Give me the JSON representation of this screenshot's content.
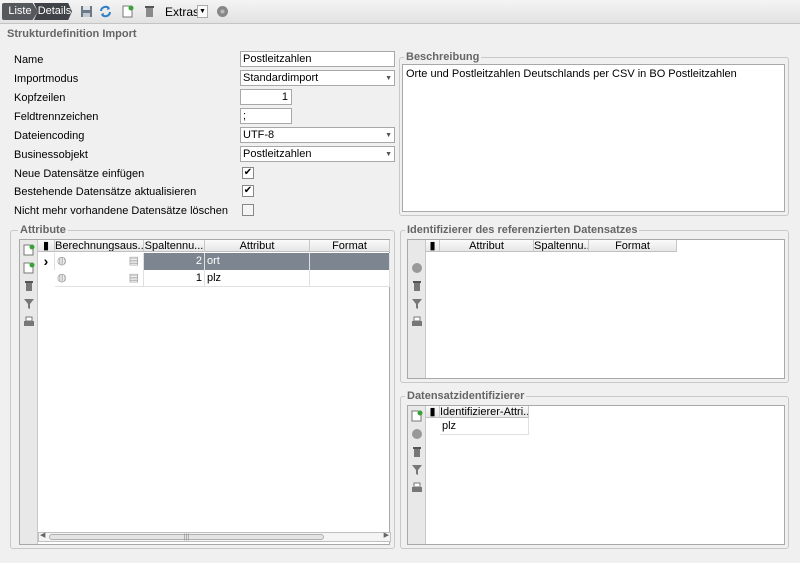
{
  "toolbar": {
    "breadcrumb": [
      "Liste",
      "Details"
    ],
    "extras_label": "Extras"
  },
  "form": {
    "section_title": "Strukturdefinition Import",
    "name_label": "Name",
    "name_value": "Postleitzahlen",
    "importmodus_label": "Importmodus",
    "importmodus_value": "Standardimport",
    "kopfzeilen_label": "Kopfzeilen",
    "kopfzeilen_value": "1",
    "feldtrenn_label": "Feldtrennzeichen",
    "feldtrenn_value": ";",
    "encoding_label": "Dateiencoding",
    "encoding_value": "UTF-8",
    "bo_label": "Businessobjekt",
    "bo_value": "Postleitzahlen",
    "neue_label": "Neue Datensätze einfügen",
    "neue_checked": true,
    "bestehende_label": "Bestehende Datensätze aktualisieren",
    "bestehende_checked": true,
    "nicht_mehr_label": "Nicht mehr vorhandene Datensätze löschen",
    "nicht_mehr_checked": false
  },
  "beschreibung": {
    "title": "Beschreibung",
    "text": "Orte und Postleitzahlen Deutschlands per CSV in BO Postleitzahlen"
  },
  "attribute": {
    "title": "Attribute",
    "columns": [
      "Berechnungsaus...",
      "Spaltennu...",
      "Attribut",
      "Format"
    ],
    "rows": [
      {
        "spalte": "2",
        "attribut": "ort",
        "selected": true
      },
      {
        "spalte": "1",
        "attribut": "plz",
        "selected": false
      }
    ]
  },
  "identifizierer": {
    "title": "Identifizierer des referenzierten Datensatzes",
    "columns": [
      "Attribut",
      "Spaltennu...",
      "Format"
    ]
  },
  "datensatz": {
    "title": "Datensatzidentifizierer",
    "columns": [
      "Identifizierer-Attri..."
    ],
    "rows": [
      "plz"
    ]
  }
}
